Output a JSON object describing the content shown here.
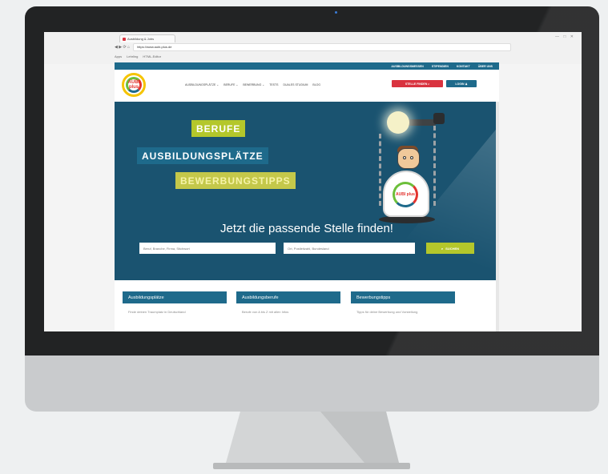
{
  "browser": {
    "tab_title": "Ausbildung & Jobs",
    "window_controls": "— □ ✕",
    "url": "https://www.aubi-plus.de",
    "nav_buttons": "◀ ▶ ⟳ ⌂",
    "bookmarks": [
      "Apps",
      "Lehrling",
      "HTML-Editor"
    ]
  },
  "site": {
    "topbar_links": [
      "AUSBILDUNGSMESSEN",
      "STIPENDIEN",
      "KONTAKT",
      "ÜBER UNS"
    ],
    "logo_line1": "AUBI",
    "logo_line2": "plus",
    "nav_items": [
      "AUSBILDUNGSPLÄTZE ⌄",
      "BERUFE ⌄",
      "BEWERBUNG ⌄",
      "TESTS",
      "DUALES STUDIUM",
      "BLOG"
    ],
    "offer_button": "STELLE FINDEN ⌕",
    "login_button": "LOGIN ♟",
    "hero": {
      "tag1": "BERUFE",
      "tag2": "AUSBILDUNGSPLÄTZE",
      "tag3": "BEWERBUNGSTIPPS",
      "robot_badge": "AUBI plus",
      "headline": "Jetzt die passende Stelle finden!",
      "job_placeholder": "Beruf, Branche, Firma, Stichwort",
      "location_placeholder": "Ort, Postleitzahl, Bundesland",
      "search_label": "SUCHEN",
      "search_icon": "⌕"
    },
    "cards": [
      {
        "title": "Ausbildungsplätze",
        "text": "Finde deinen Traumplatz in Deutschland"
      },
      {
        "title": "Ausbildungsberufe",
        "text": "Berufe von A bis Z mit allen Infos"
      },
      {
        "title": "Bewerbungstipps",
        "text": "Tipps für deine Bewerbung und Vorstellung"
      }
    ]
  },
  "colors": {
    "primary": "#1e6a8b",
    "hero_bg": "#1a5370",
    "accent_green": "#b4c72b",
    "accent_red": "#d9333f",
    "bezel": "#222324",
    "chin": "#c9cbcd"
  }
}
